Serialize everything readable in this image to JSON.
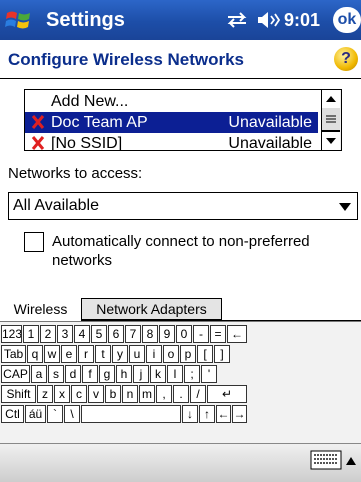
{
  "titlebar": {
    "app_title": "Settings",
    "time": "9:01",
    "ok_label": "ok"
  },
  "header": {
    "title": "Configure Wireless Networks",
    "help": "?"
  },
  "networks": {
    "items": [
      {
        "name": "Add New...",
        "status": ""
      },
      {
        "name": "Doc Team AP",
        "status": "Unavailable"
      },
      {
        "name": "[No SSID]",
        "status": "Unavailable"
      }
    ],
    "selected_index": 1
  },
  "access": {
    "label": "Networks to access:",
    "selected": "All Available"
  },
  "auto_connect": {
    "label": "Automatically connect to non-preferred networks",
    "checked": false
  },
  "tabs": [
    {
      "label": "Wireless",
      "active": true
    },
    {
      "label": "Network Adapters",
      "active": false
    }
  ],
  "keyboard": {
    "row1": [
      "123",
      "1",
      "2",
      "3",
      "4",
      "5",
      "6",
      "7",
      "8",
      "9",
      "0",
      "-",
      "=",
      "←"
    ],
    "row2": [
      "Tab",
      "q",
      "w",
      "e",
      "r",
      "t",
      "y",
      "u",
      "i",
      "o",
      "p",
      "[",
      "]"
    ],
    "row3": [
      "CAP",
      "a",
      "s",
      "d",
      "f",
      "g",
      "h",
      "j",
      "k",
      "l",
      ";",
      "'"
    ],
    "row4": [
      "Shift",
      "z",
      "x",
      "c",
      "v",
      "b",
      "n",
      "m",
      ",",
      ".",
      "/",
      "↵"
    ],
    "row5": [
      "Ctl",
      "áü",
      "`",
      "\\",
      "",
      "↓",
      "↑",
      "←",
      "→"
    ]
  }
}
